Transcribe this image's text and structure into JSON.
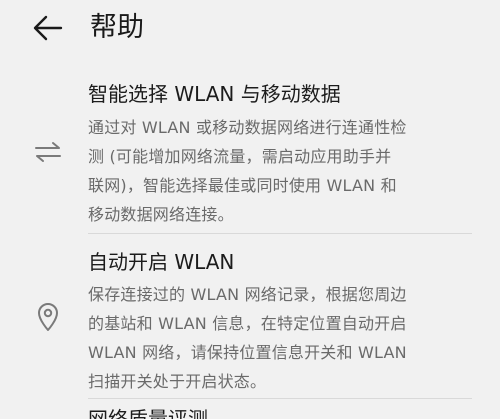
{
  "header": {
    "title": "帮助",
    "back_icon": "arrow-left-icon"
  },
  "items": [
    {
      "icon": "swap-arrows-icon",
      "title": "智能选择 WLAN 与移动数据",
      "lines": [
        "通过对 WLAN 或移动数据网络进行连通性检",
        "测 (可能增加网络流量，需启动应用助手并",
        "联网)，智能选择最佳或同时使用 WLAN 和",
        "移动数据网络连接。"
      ]
    },
    {
      "icon": "location-pin-icon",
      "title": "自动开启 WLAN",
      "lines": [
        "保存连接过的 WLAN 网络记录，根据您周边",
        "的基站和 WLAN 信息，在特定位置自动开启",
        "WLAN 网络，请保持位置信息开关和 WLAN",
        "扫描开关处于开启状态。"
      ]
    },
    {
      "title": "网络质量评测"
    }
  ]
}
